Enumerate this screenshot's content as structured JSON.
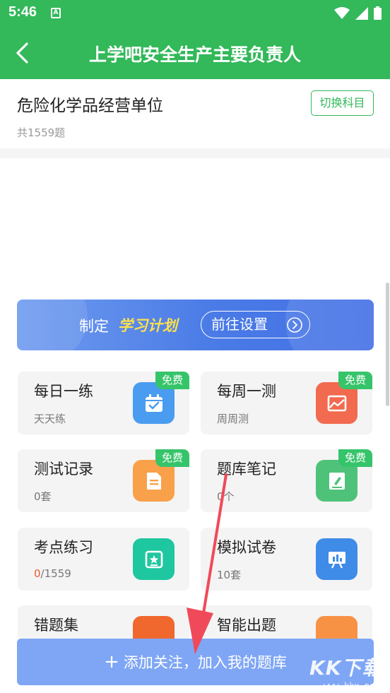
{
  "status_bar": {
    "time": "5:46",
    "app_badge": "A"
  },
  "header": {
    "title": "上学吧安全生产主要负责人"
  },
  "subject": {
    "title": "危险化学品经营单位",
    "count": "共1559题",
    "switch_label": "切换科目"
  },
  "plan_banner": {
    "prefix": "制定",
    "highlight": "学习计划",
    "button_label": "前往设置"
  },
  "cards": [
    {
      "title": "每日一练",
      "sub": "天天练",
      "badge": "免费",
      "icon": "calendar-check-icon",
      "color": "#4a9cf0"
    },
    {
      "title": "每周一测",
      "sub": "周周测",
      "badge": "免费",
      "icon": "image-chart-icon",
      "color": "#f26a4f"
    },
    {
      "title": "测试记录",
      "sub": "0套",
      "badge": "免费",
      "icon": "document-icon",
      "color": "#f8a14a"
    },
    {
      "title": "题库笔记",
      "sub": "0个",
      "badge": "免费",
      "icon": "notebook-icon",
      "color": "#4fc27a"
    },
    {
      "title": "考点练习",
      "sub_done": "0",
      "sub_total": "/1559",
      "icon": "star-board-icon",
      "color": "#1fc7a0"
    },
    {
      "title": "模拟试卷",
      "sub": "10套",
      "icon": "presentation-icon",
      "color": "#3f8be8"
    },
    {
      "title": "错题集",
      "icon": "error-book-icon",
      "color": "#f0682e"
    },
    {
      "title": "智能出题",
      "icon": "smart-question-icon",
      "color": "#f79245"
    }
  ],
  "follow_button": {
    "label": "添加关注，加入我的题库"
  },
  "watermark": {
    "text": "KK下载",
    "url": "www.kkx.net"
  }
}
